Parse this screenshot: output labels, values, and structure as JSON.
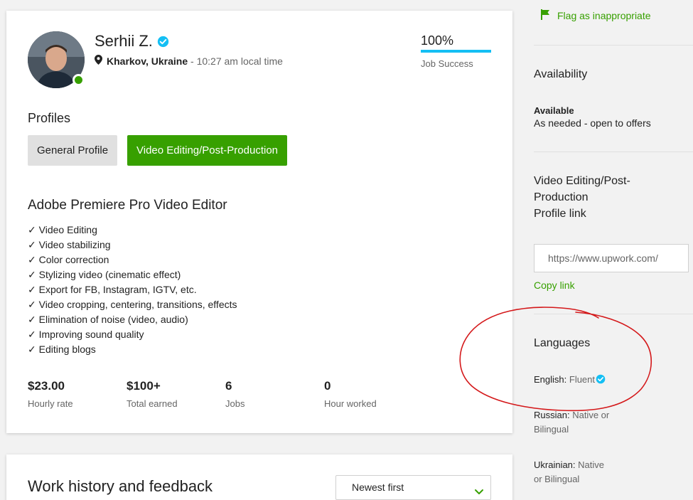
{
  "profile": {
    "name": "Serhii Z.",
    "location_city": "Kharkov, Ukraine",
    "location_time": " - 10:27 am local time",
    "job_success": {
      "value": "100%",
      "fraction": 1.0,
      "label": "Job Success"
    },
    "online": true
  },
  "profiles_section": {
    "heading": "Profiles",
    "tabs": [
      {
        "label": "General Profile",
        "active": false
      },
      {
        "label": "Video Editing/Post-Production",
        "active": true
      }
    ]
  },
  "title": "Adobe Premiere Pro Video Editor",
  "skills": [
    "✓ Video Editing",
    "✓ Video stabilizing",
    "✓ Color correction",
    "✓ Stylizing video (cinematic effect)",
    "✓ Export for FB, Instagram, IGTV, etc.",
    "✓ Video cropping, centering, transitions, effects",
    "✓ Elimination of noise (video, audio)",
    "✓ Improving sound quality",
    "✓ Editing blogs"
  ],
  "stats": [
    {
      "value": "$23.00",
      "label": "Hourly rate"
    },
    {
      "value": "$100+",
      "label": "Total earned"
    },
    {
      "value": "6",
      "label": "Jobs"
    },
    {
      "value": "0",
      "label": "Hour worked"
    }
  ],
  "work_history": {
    "title": "Work history and feedback",
    "sort_value": "Newest first"
  },
  "sidebar": {
    "flag_label": "Flag as inappropriate",
    "availability": {
      "heading": "Availability",
      "status": "Available",
      "detail": "As needed - open to offers"
    },
    "profile_link": {
      "heading_line1": "Video Editing/Post-",
      "heading_line2": "Production",
      "heading_line3": "Profile link",
      "url": "https://www.upwork.com/",
      "copy_label": "Copy link"
    },
    "languages": {
      "heading": "Languages",
      "items": [
        {
          "name": "English:",
          "level": "Fluent",
          "verified": true
        },
        {
          "name": "Russian:",
          "level_line1": "Native or",
          "level_line2": "Bilingual"
        },
        {
          "name": "Ukrainian:",
          "level_line1": "Native",
          "level_line2": "or Bilingual"
        }
      ]
    }
  },
  "colors": {
    "accent_green": "#37a000",
    "verified_blue": "#14bff4",
    "annotation_red": "#d4181a"
  },
  "icons": [
    "verified-icon",
    "location-pin-icon",
    "flag-icon",
    "chevron-down-icon"
  ]
}
